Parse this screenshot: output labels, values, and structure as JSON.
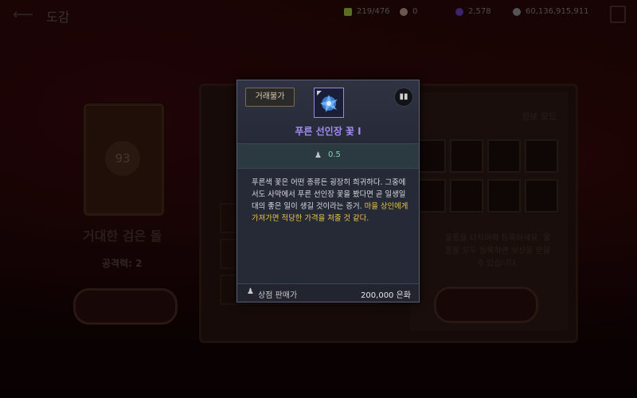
{
  "header": {
    "title": "도감",
    "back_icon": "back-arrow-icon"
  },
  "resources": [
    {
      "name": "energy",
      "value": "219/476",
      "color": "#a8c840"
    },
    {
      "name": "pearl",
      "value": "0",
      "color": "#c0a090"
    },
    {
      "name": "crystal",
      "value": "2,578",
      "color": "#7040c0"
    },
    {
      "name": "silver",
      "value": "60,136,915,911",
      "color": "#9a9a9a"
    }
  ],
  "card": {
    "level": "93",
    "name": "거대한 검은 돌",
    "attack": "공격력: 2"
  },
  "book": {
    "info_mode": "정보 모드",
    "hint": "물품을 타치하여 등록하세요. 물품을 모두 등록하면 보상을 받을 수 있습니다."
  },
  "tooltip": {
    "trade_label": "거래불가",
    "item_name": "푸른 선인장 꽃 I",
    "weight": "0.5",
    "description": "푸른색 꽃은 어떤 종류든 굉장히 희귀하다. 그중에서도 사막에서 푸른 선인장 꽃을 봤다면 곧 일생일대의 좋은 일이 생길 것이라는 증거.",
    "highlight": "마을 상인에게 가져가면 적당한 가격을 쳐줄 것 같다.",
    "price_label": "상점 판매가",
    "price_value": "200,000 은화"
  },
  "colors": {
    "accent_name": "#a38cf3",
    "highlight": "#e8c44a",
    "weight": "#7fd4b0"
  }
}
